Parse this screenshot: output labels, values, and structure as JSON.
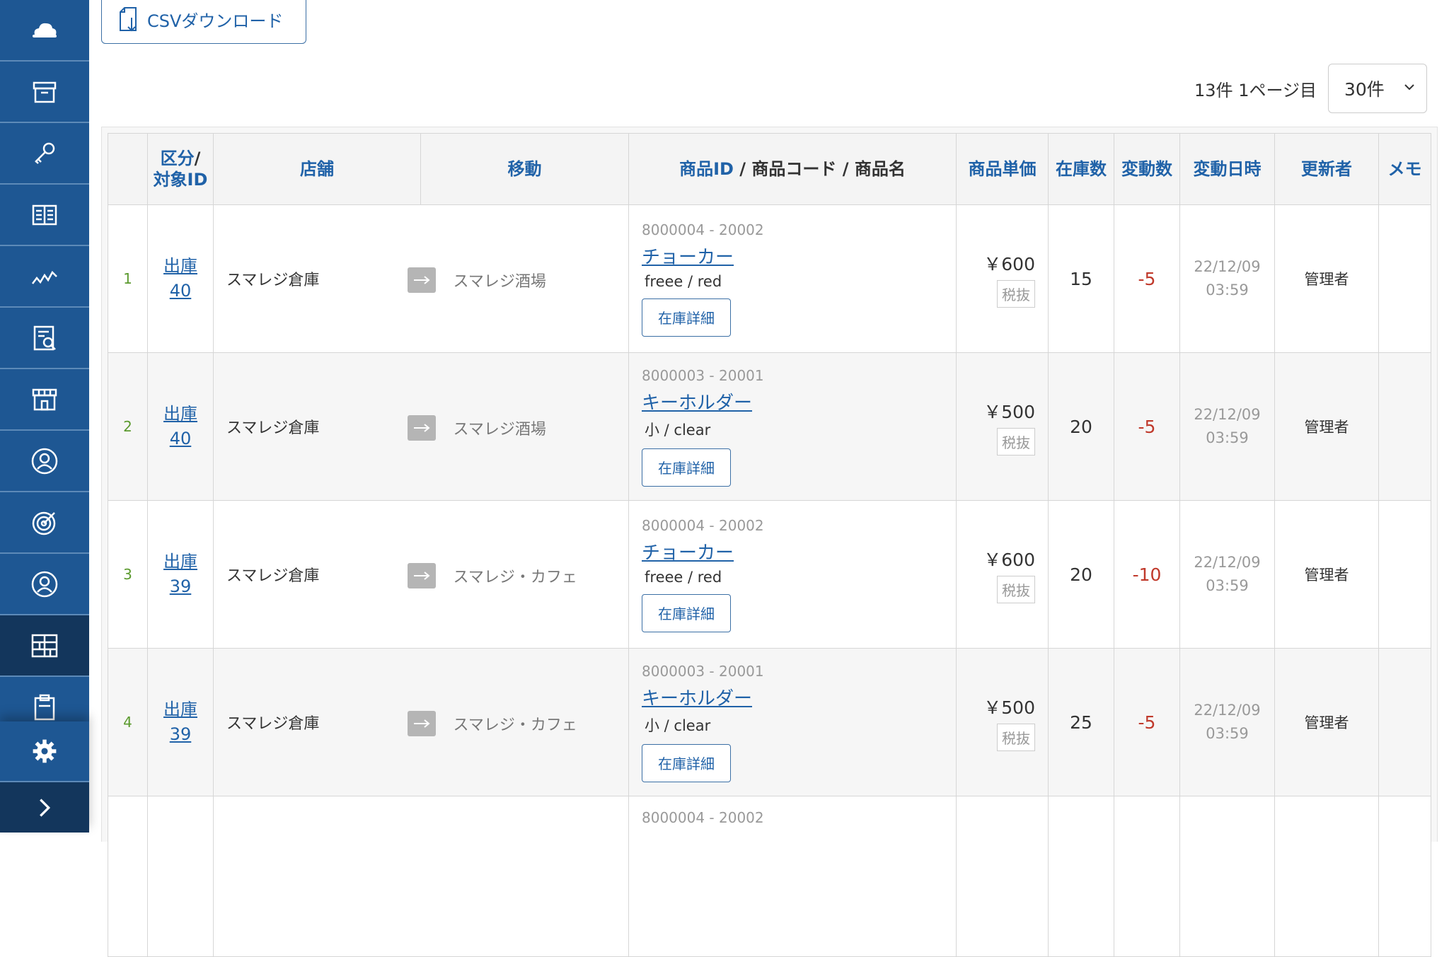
{
  "toolbar": {
    "csv_label": "CSVダウンロード"
  },
  "pagination": {
    "info": "13件 1ページ目",
    "per_page": "30件"
  },
  "table": {
    "headers": {
      "kubun_line1": "区分",
      "kubun_slash": "/",
      "kubun_line2": "対象ID",
      "store": "店舗",
      "move": "移動",
      "product_id": "商品ID",
      "product_sep1": " / ",
      "product_code": "商品コード",
      "product_sep2": " / ",
      "product_name": "商品名",
      "unit_price": "商品単価",
      "stock": "在庫数",
      "change": "変動数",
      "datetime": "変動日時",
      "updater": "更新者",
      "memo": "メモ"
    },
    "rows": [
      {
        "no": "1",
        "type": "出庫",
        "target_id": "40",
        "store": "スマレジ倉庫",
        "dest": "スマレジ酒場",
        "product_id_code": "8000004 - 20002",
        "product_name": "チョーカー",
        "variant": "freee  / red",
        "stock_btn": "在庫詳細",
        "price": "￥600",
        "tax": "税抜",
        "stock": "15",
        "change": "-5",
        "date": "22/12/09",
        "time": "03:59",
        "updater": "管理者"
      },
      {
        "no": "2",
        "type": "出庫",
        "target_id": "40",
        "store": "スマレジ倉庫",
        "dest": "スマレジ酒場",
        "product_id_code": "8000003 - 20001",
        "product_name": "キーホルダー",
        "variant": "小  / clear",
        "stock_btn": "在庫詳細",
        "price": "￥500",
        "tax": "税抜",
        "stock": "20",
        "change": "-5",
        "date": "22/12/09",
        "time": "03:59",
        "updater": "管理者"
      },
      {
        "no": "3",
        "type": "出庫",
        "target_id": "39",
        "store": "スマレジ倉庫",
        "dest": "スマレジ・カフェ",
        "product_id_code": "8000004 - 20002",
        "product_name": "チョーカー",
        "variant": "freee  / red",
        "stock_btn": "在庫詳細",
        "price": "￥600",
        "tax": "税抜",
        "stock": "20",
        "change": "-10",
        "date": "22/12/09",
        "time": "03:59",
        "updater": "管理者"
      },
      {
        "no": "4",
        "type": "出庫",
        "target_id": "39",
        "store": "スマレジ倉庫",
        "dest": "スマレジ・カフェ",
        "product_id_code": "8000003 - 20001",
        "product_name": "キーホルダー",
        "variant": "小  / clear",
        "stock_btn": "在庫詳細",
        "price": "￥500",
        "tax": "税抜",
        "stock": "25",
        "change": "-5",
        "date": "22/12/09",
        "time": "03:59",
        "updater": "管理者"
      },
      {
        "product_id_code": "8000004 - 20002"
      }
    ]
  },
  "sidebar": {
    "items": [
      {
        "icon": "cloud-icon"
      },
      {
        "icon": "archive-icon"
      },
      {
        "icon": "key-icon"
      },
      {
        "icon": "book-icon"
      },
      {
        "icon": "chart-line-icon"
      },
      {
        "icon": "report-search-icon"
      },
      {
        "icon": "store-icon"
      },
      {
        "icon": "user-circle-icon"
      },
      {
        "icon": "target-icon"
      },
      {
        "icon": "customer-icon"
      },
      {
        "icon": "inventory-grid-icon",
        "active": true
      },
      {
        "icon": "clipboard-icon"
      },
      {
        "icon": "gear-icon"
      },
      {
        "icon": "chevron-right-icon"
      }
    ]
  },
  "colors": {
    "sidebar": "#1e5793",
    "sidebar_active": "#13365c",
    "link": "#2062a8",
    "negative": "#c0392b",
    "row_number": "#5b9a2e"
  }
}
